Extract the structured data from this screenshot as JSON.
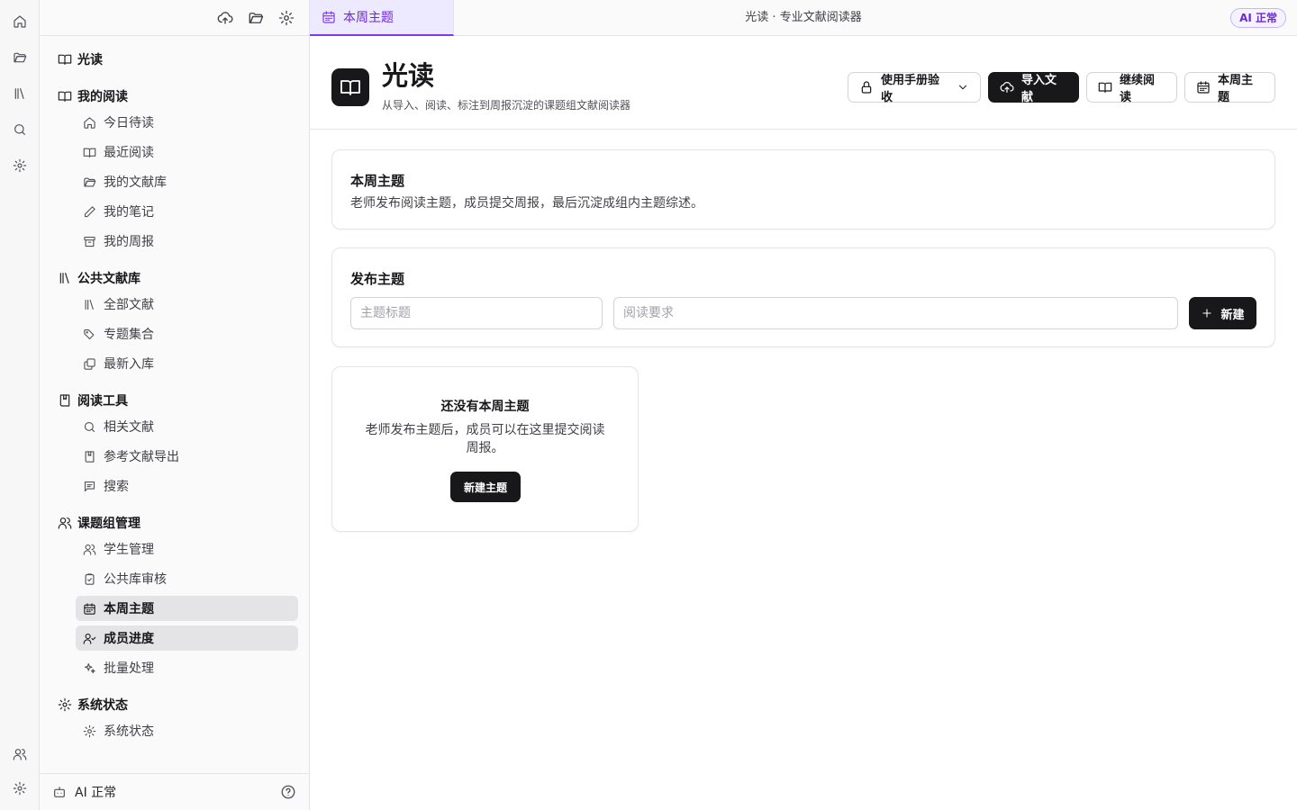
{
  "app": {
    "window_title": "光读 · 专业文献阅读器",
    "ai_badge": "AI 正常"
  },
  "tab": {
    "label": "本周主题",
    "icon": "calendar-icon"
  },
  "sidebar": {
    "brand": "光读",
    "groups": [
      {
        "label": "我的阅读",
        "items": [
          "今日待读",
          "最近阅读",
          "我的文献库",
          "我的笔记",
          "我的周报"
        ]
      },
      {
        "label": "公共文献库",
        "items": [
          "全部文献",
          "专题集合",
          "最新入库"
        ]
      },
      {
        "label": "阅读工具",
        "items": [
          "相关文献",
          "参考文献导出",
          "搜索"
        ]
      },
      {
        "label": "课题组管理",
        "items": [
          "学生管理",
          "公共库审核",
          "本周主题",
          "成员进度",
          "批量处理"
        ]
      },
      {
        "label": "系统状态",
        "items": [
          "系统状态"
        ]
      }
    ],
    "active_items": [
      "本周主题",
      "成员进度"
    ],
    "footer_label": "AI 正常"
  },
  "header": {
    "title": "光读",
    "subtitle": "从导入、阅读、标注到周报沉淀的课题组文献阅读器",
    "buttons": {
      "manual": "使用手册验收",
      "import": "导入文献",
      "continue": "继续阅读",
      "weekly": "本周主题"
    }
  },
  "intro_card": {
    "title": "本周主题",
    "desc": "老师发布阅读主题，成员提交周报，最后沉淀成组内主题综述。"
  },
  "publish_card": {
    "title": "发布主题",
    "title_placeholder": "主题标题",
    "req_placeholder": "阅读要求",
    "new_button": "新建"
  },
  "empty_card": {
    "title": "还没有本周主题",
    "desc": "老师发布主题后，成员可以在这里提交阅读周报。",
    "button": "新建主题"
  },
  "colors": {
    "accent": "#7c3aed",
    "dark": "#18181b",
    "active_bg": "#e4e4e7"
  }
}
